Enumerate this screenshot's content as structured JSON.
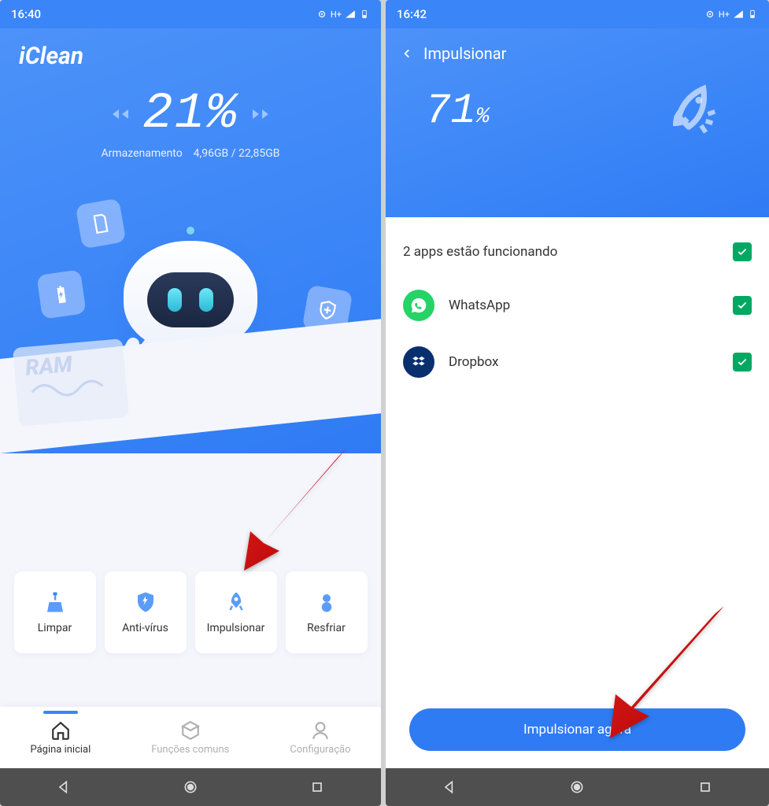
{
  "left": {
    "status": {
      "time": "16:40",
      "signal": "H+"
    },
    "app_name": "iClean",
    "percent": "21%",
    "storage_label": "Armazenamento",
    "storage_used": "4,96GB",
    "storage_sep": "/",
    "storage_total": "22,85GB",
    "ram_label": "RAM",
    "tiles": [
      {
        "label": "Limpar"
      },
      {
        "label": "Anti-vírus"
      },
      {
        "label": "Impulsionar"
      },
      {
        "label": "Resfriar"
      }
    ],
    "tabs": [
      {
        "label": "Página inicial",
        "active": true
      },
      {
        "label": "Funções comuns",
        "active": false
      },
      {
        "label": "Configuração",
        "active": false
      }
    ]
  },
  "right": {
    "status": {
      "time": "16:42",
      "signal": "H+"
    },
    "title": "Impulsionar",
    "percent_num": "71",
    "percent_sym": "%",
    "list_header": "2 apps estão funcionando",
    "apps": [
      {
        "name": "WhatsApp",
        "checked": true
      },
      {
        "name": "Dropbox",
        "checked": true
      }
    ],
    "cta": "Impulsionar agora"
  }
}
